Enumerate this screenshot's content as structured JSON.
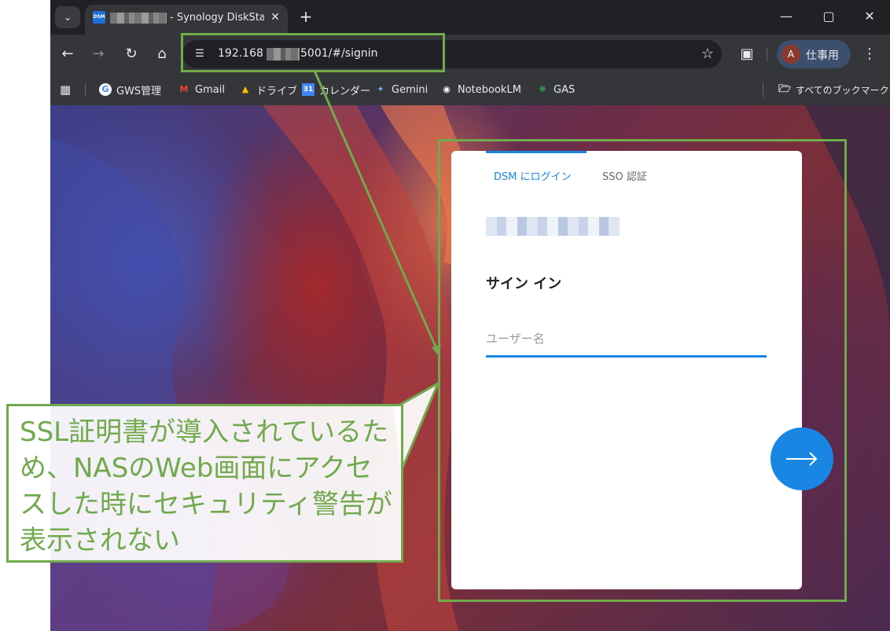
{
  "browser": {
    "tab": {
      "favicon_text": "DSM",
      "title_suffix": "- Synology DiskStat",
      "close_icon": "close-icon"
    },
    "window_controls": [
      "minimize-icon",
      "maximize-icon",
      "close-icon"
    ],
    "address": {
      "url_prefix": "192.168",
      "url_suffix": "5001/#/signin"
    },
    "profile": {
      "initial": "A",
      "label": "仕事用"
    },
    "bookmarks": [
      {
        "label": "GWS管理",
        "icon": "google-icon"
      },
      {
        "label": "Gmail",
        "icon": "gmail-icon"
      },
      {
        "label": "ドライブ",
        "icon": "drive-icon"
      },
      {
        "label": "カレンダー",
        "icon": "calendar-icon"
      },
      {
        "label": "Gemini",
        "icon": "gemini-icon"
      },
      {
        "label": "NotebookLM",
        "icon": "notebooklm-icon"
      },
      {
        "label": "GAS",
        "icon": "gas-icon"
      }
    ],
    "all_bookmarks": "すべてのブックマーク"
  },
  "login": {
    "tabs": [
      "DSM にログイン",
      "SSO 認証"
    ],
    "active_tab": 0,
    "title": "サイン イン",
    "username_placeholder": "ユーザー名"
  },
  "annotation": {
    "text": "SSL証明書が導入されているため、NASのWeb画面にアクセスした時にセキュリティ警告が表示されない",
    "color": "#71a94d"
  },
  "colors": {
    "accent": "#1a86e3",
    "highlight": "#71a94d",
    "browser_dark": "#202124"
  }
}
